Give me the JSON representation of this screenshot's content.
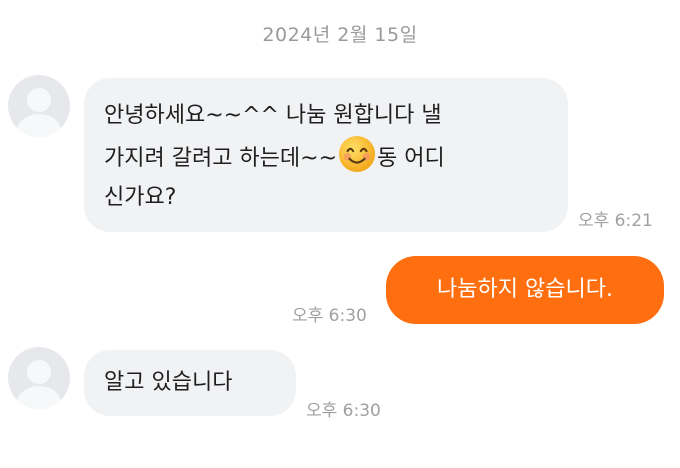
{
  "date_header": "2024년 2월 15일",
  "messages": [
    {
      "line1": "안녕하세요~~^^ 나눔 원합니다 낼",
      "line2_before": "가지려 갈려고 하는데~~",
      "line2_emoji": "smiling-face-emoji",
      "line2_after": "동 어디",
      "line3": "신가요?",
      "time": "오후 6:21"
    },
    {
      "text": "나눔하지 않습니다.",
      "time": "오후 6:30"
    },
    {
      "text": "알고 있습니다",
      "time": "오후 6:30"
    }
  ],
  "colors": {
    "outgoing_bubble": "#ff6f0f",
    "incoming_bubble": "#f1f2f4",
    "timestamp": "#a0a0a0"
  }
}
